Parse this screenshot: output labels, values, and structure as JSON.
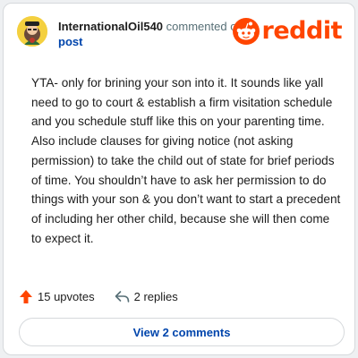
{
  "header": {
    "username": "InternationalOil540",
    "action_text": "commented on",
    "post_link": "post"
  },
  "logo": {
    "wordmark": "reddit",
    "brand_color": "#ff4500"
  },
  "comment": {
    "body": "YTA- only for brining your son into it. It sounds like yall need to go to court & establish a firm visitation schedule and you schedule stuff like this on your parenting time. Also include clauses for giving notice (not asking permission) to take the child out of state for brief periods of time. You shouldn’t have to ask her permission to do things with your son & you don’t want to start a precedent of including her other child, because she will then come to expect it."
  },
  "actions": {
    "upvotes_label": "15 upvotes",
    "replies_label": "2 replies",
    "upvote_icon": "arrow-up-icon",
    "reply_icon": "reply-arrow-icon",
    "upvote_color": "#ff4500"
  },
  "view_comments": {
    "label": "View 2 comments"
  },
  "colors": {
    "link": "#0045ac",
    "muted": "#576f76",
    "text": "#1c1c1c"
  }
}
